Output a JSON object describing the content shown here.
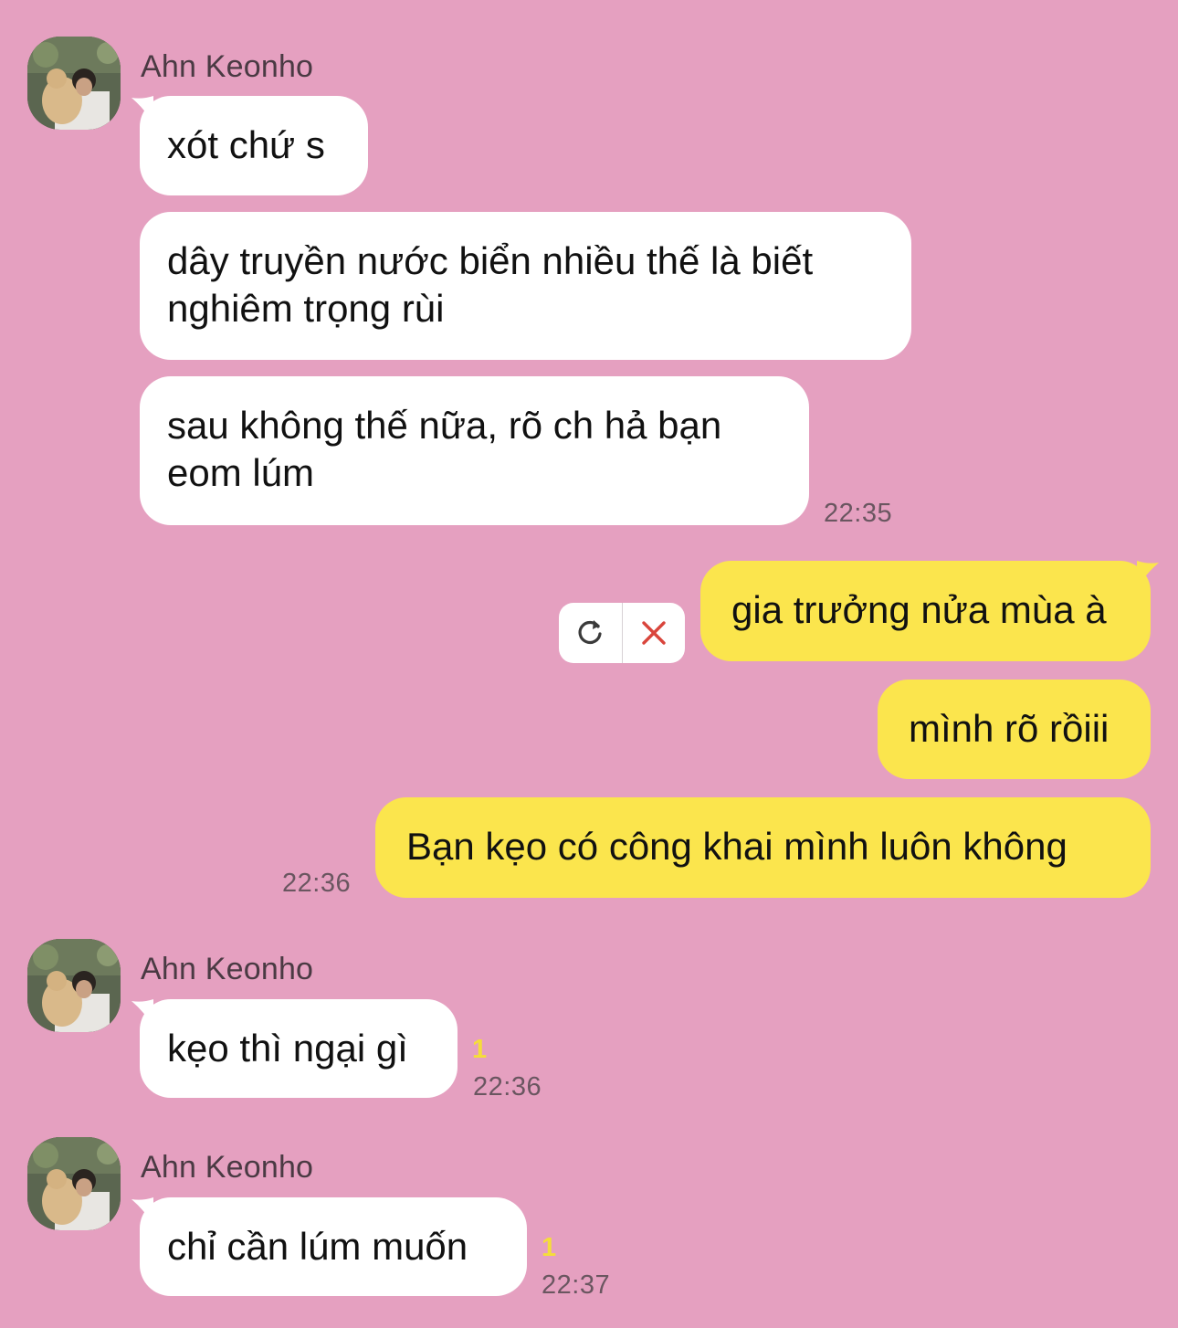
{
  "contact": {
    "name": "Ahn Keonho",
    "avatar_icon": "profile-photo"
  },
  "colors": {
    "background": "#e5a0c0",
    "incoming_bubble": "#ffffff",
    "outgoing_bubble": "#fbe54d",
    "unread_count": "#f5dd3a",
    "delete_x": "#d9453c"
  },
  "groups": [
    {
      "sender": "Ahn Keonho",
      "messages": [
        {
          "text": "xót chứ s"
        },
        {
          "text": "dây truyền nước biển nhiều thế là biết nghiêm trọng rùi"
        },
        {
          "text": "sau không thế nữa, rõ ch hả bạn eom lúm"
        }
      ],
      "time": "22:35"
    },
    {
      "sender": "me",
      "messages": [
        {
          "text": "gia trưởng nửa mùa à",
          "failed": true
        },
        {
          "text": "mình rõ rồiii"
        },
        {
          "text": "Bạn kẹo có công khai mình luôn không"
        }
      ],
      "time": "22:36"
    },
    {
      "sender": "Ahn Keonho",
      "messages": [
        {
          "text": "kẹo thì ngại gì"
        }
      ],
      "unread": "1",
      "time": "22:36"
    },
    {
      "sender": "Ahn Keonho",
      "messages": [
        {
          "text": "chỉ cần lúm muốn"
        }
      ],
      "unread": "1",
      "time": "22:37"
    }
  ],
  "fail_controls": {
    "resend_icon": "refresh-icon",
    "delete_icon": "close-icon"
  }
}
